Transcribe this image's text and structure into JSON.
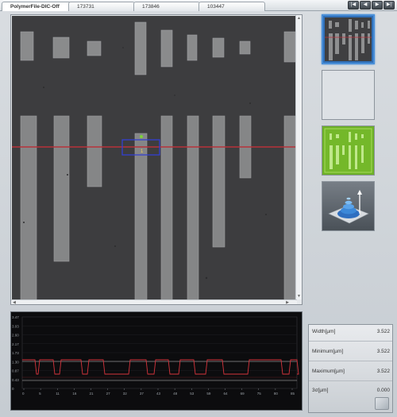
{
  "tabs": [
    {
      "label": "PolymerFile-DIC-Off",
      "active": true
    },
    {
      "label": "173731",
      "active": false
    },
    {
      "label": "173846",
      "active": false
    },
    {
      "label": "103447",
      "active": false
    }
  ],
  "nav_buttons": [
    {
      "icon": "first-icon",
      "glyph": "|◀"
    },
    {
      "icon": "prev-icon",
      "glyph": "◀"
    },
    {
      "icon": "next-icon",
      "glyph": "▶"
    },
    {
      "icon": "last-icon",
      "glyph": "▶|"
    }
  ],
  "thumbnails": [
    {
      "icon": "grayscale-image-icon",
      "selected": true
    },
    {
      "icon": "blank-image-icon",
      "selected": false
    },
    {
      "icon": "height-map-icon",
      "selected": false
    },
    {
      "icon": "3d-view-icon",
      "selected": false
    }
  ],
  "profile": {
    "y_ticks": [
      "3.47",
      "3.03",
      "2.60",
      "2.17",
      "1.73",
      "1.30",
      "0.87",
      "0.43",
      "0"
    ],
    "x_ticks": [
      "0",
      "5",
      "11",
      "16",
      "21",
      "27",
      "32",
      "37",
      "43",
      "48",
      "53",
      "59",
      "64",
      "69",
      "75",
      "80",
      "85"
    ],
    "colors": {
      "profile_line": "#d6343c",
      "cursor_line": "#c8c8c8"
    }
  },
  "measurement": {
    "marker_label": "1",
    "colors": {
      "section_line": "#b8323a",
      "roi_box": "#3440d0",
      "marker": "#7dd23a"
    }
  },
  "stats": [
    {
      "label": "Width[µm]",
      "value": "3.522"
    },
    {
      "label": "Minimum[µm]",
      "value": "3.522"
    },
    {
      "label": "Maximum[µm]",
      "value": "3.522"
    },
    {
      "label": "3σ[µm]",
      "value": "0.000"
    }
  ]
}
